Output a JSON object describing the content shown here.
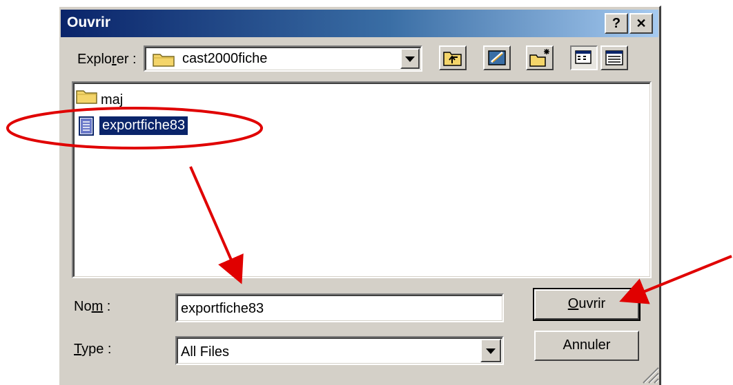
{
  "window": {
    "title": "Ouvrir"
  },
  "caption_buttons": {
    "help": "?",
    "close": "✕"
  },
  "look_in": {
    "label_pre": "Explo",
    "label_key": "r",
    "label_post": "er :",
    "folder": "cast2000fiche"
  },
  "files": [
    {
      "name": "maj",
      "kind": "folder-icon"
    },
    {
      "name": "exportfiche83",
      "kind": "document-icon",
      "selected": true
    }
  ],
  "filename": {
    "label_pre": "No",
    "label_key": "m",
    "label_post": " :",
    "value": "exportfiche83"
  },
  "filetype": {
    "label_key": "T",
    "label_post": "ype :",
    "value": "All Files"
  },
  "buttons": {
    "open_key": "O",
    "open_rest": "uvrir",
    "cancel": "Annuler"
  },
  "colors": {
    "titlebar_start": "#0a246a",
    "titlebar_end": "#a6caf0",
    "selection": "#0a246a",
    "annotation_red": "#e00000"
  }
}
